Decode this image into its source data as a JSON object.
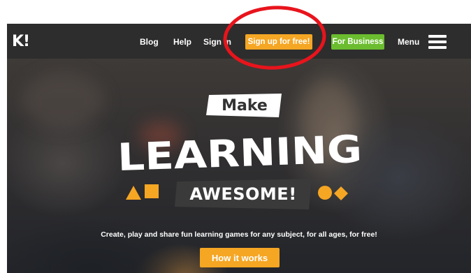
{
  "brand": {
    "logo_text": "K!"
  },
  "nav": {
    "links": [
      "Blog",
      "Help",
      "Sign in"
    ],
    "signup_label": "Sign up for free!",
    "business_label": "For Business",
    "menu_label": "Menu",
    "menu_icon": "hamburger-icon"
  },
  "hero": {
    "make": "Make",
    "learning": "LEARNING",
    "awesome": "AWESOME!",
    "subtitle": "Create, play and share fun learning games for any subject, for all ages, for free!",
    "cta_label": "How it works",
    "shapes": [
      "triangle",
      "square",
      "circle",
      "diamond"
    ]
  },
  "annotation": {
    "type": "red-circle",
    "color": "#e8141c"
  },
  "colors": {
    "navbar": "#2d2d2d",
    "orange": "#f5a623",
    "green": "#6bbd2f",
    "white": "#ffffff"
  }
}
